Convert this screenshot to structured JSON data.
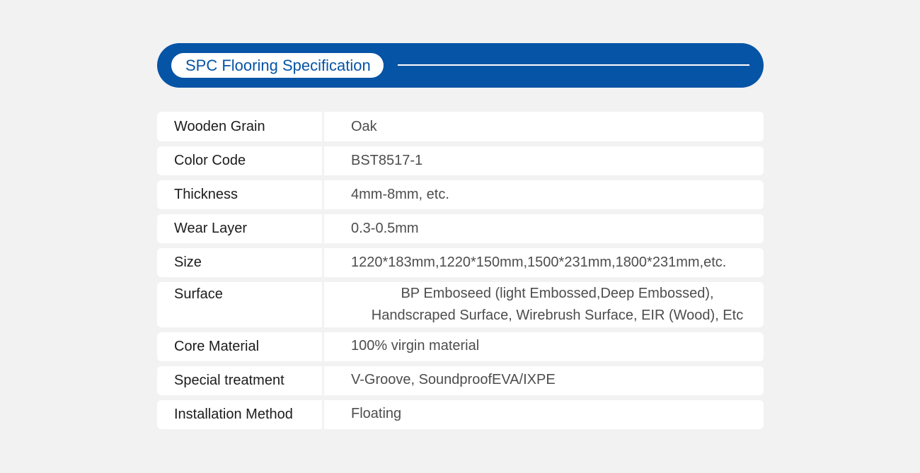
{
  "header": {
    "title": "SPC Flooring Specification"
  },
  "specs": [
    {
      "label": "Wooden Grain",
      "value": "Oak"
    },
    {
      "label": "Color Code",
      "value": "BST8517-1"
    },
    {
      "label": "Thickness",
      "value": "4mm-8mm, etc."
    },
    {
      "label": "Wear Layer",
      "value": "0.3-0.5mm"
    },
    {
      "label": "Size",
      "value": "1220*183mm,1220*150mm,1500*231mm,1800*231mm,etc."
    },
    {
      "label": "Surface",
      "value_line1": "BP Emboseed (light Embossed,Deep Embossed),",
      "value_line2": "Handscraped Surface, Wirebrush Surface, EIR (Wood), Etc"
    },
    {
      "label": "Core Material",
      "value": "100% virgin material"
    },
    {
      "label": "Special treatment",
      "value": "V-Groove, SoundproofEVA/IXPE"
    },
    {
      "label": "Installation Method",
      "value": "Floating"
    }
  ],
  "colors": {
    "accent": "#0654a6",
    "background": "#f2f2f2",
    "row": "#ffffff"
  }
}
